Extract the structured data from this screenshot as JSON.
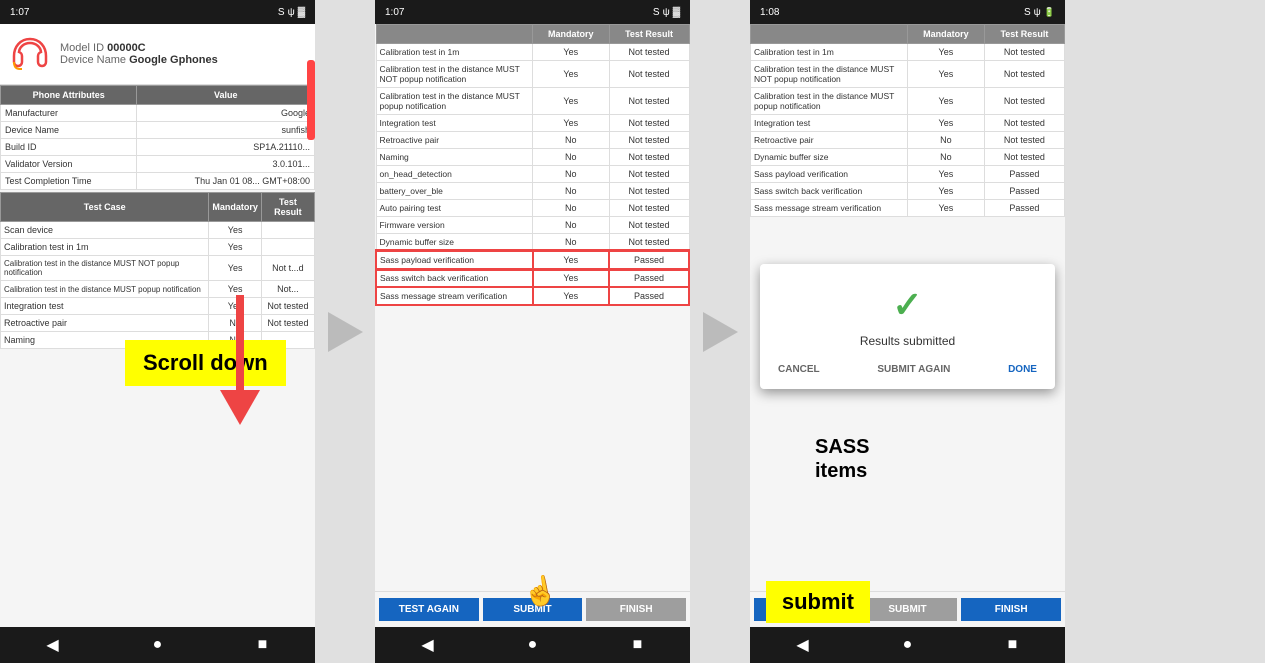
{
  "screen1": {
    "statusbar": {
      "time": "1:07",
      "icons": "S ψ ▲"
    },
    "device": {
      "model_label": "Model ID",
      "model_value": "00000C",
      "name_label": "Device Name",
      "name_value": "Google Gphones"
    },
    "attributes_header": [
      "Phone Attributes",
      "Value"
    ],
    "attributes": [
      {
        "name": "Manufacturer",
        "value": "Google"
      },
      {
        "name": "Device Name",
        "value": "sunfish"
      },
      {
        "name": "Build ID",
        "value": "SP1A.21110..."
      },
      {
        "name": "Validator Version",
        "value": "3.0.101..."
      },
      {
        "name": "Test Completion Time",
        "value": "Thu Jan 01 08... GMT+08:00"
      }
    ],
    "test_header": [
      "Test Case",
      "Mandatory",
      "Test Result"
    ],
    "tests": [
      {
        "name": "Scan device",
        "mandatory": "Yes",
        "result": ""
      },
      {
        "name": "Calibration test in 1m",
        "mandatory": "Yes",
        "result": ""
      },
      {
        "name": "Calibration test in the distance MUST NOT popup notification",
        "mandatory": "Yes",
        "result": "Not t...d"
      },
      {
        "name": "Calibration test in the distance MUST popup notification",
        "mandatory": "Yes",
        "result": "Not..."
      },
      {
        "name": "Integration test",
        "mandatory": "Yes",
        "result": "Not tested"
      },
      {
        "name": "Retroactive pair",
        "mandatory": "No",
        "result": "Not tested"
      },
      {
        "name": "Naming",
        "mandatory": "No",
        "result": ""
      }
    ],
    "scroll_annotation": "Scroll down",
    "navbar": [
      "◀",
      "●",
      "■"
    ]
  },
  "screen2": {
    "statusbar": {
      "time": "1:07",
      "icons": "S ψ ▲"
    },
    "test_header": [
      "",
      "Mandatory",
      "Test Result"
    ],
    "tests": [
      {
        "name": "Calibration test in 1m",
        "mandatory": "Yes",
        "result": "Not tested"
      },
      {
        "name": "Calibration test in the distance MUST NOT popup notification",
        "mandatory": "Yes",
        "result": "Not tested"
      },
      {
        "name": "Calibration test in the distance MUST popup notification",
        "mandatory": "Yes",
        "result": "Not tested"
      },
      {
        "name": "Integration test",
        "mandatory": "Yes",
        "result": "Not tested"
      },
      {
        "name": "Retroactive pair",
        "mandatory": "No",
        "result": "Not tested"
      },
      {
        "name": "Naming",
        "mandatory": "No",
        "result": "Not tested"
      },
      {
        "name": "on_head_detection",
        "mandatory": "No",
        "result": "Not tested"
      },
      {
        "name": "battery_over_ble",
        "mandatory": "No",
        "result": "Not tested"
      },
      {
        "name": "Auto pairing test",
        "mandatory": "No",
        "result": "Not tested"
      },
      {
        "name": "Firmware version",
        "mandatory": "No",
        "result": "Not tested"
      },
      {
        "name": "Dynamic buffer size",
        "mandatory": "No",
        "result": "Not tested"
      },
      {
        "name": "Sass payload verification",
        "mandatory": "Yes",
        "result": "Passed",
        "sass": true
      },
      {
        "name": "Sass switch back verification",
        "mandatory": "Yes",
        "result": "Passed",
        "sass": true
      },
      {
        "name": "Sass message stream verification",
        "mandatory": "Yes",
        "result": "Passed",
        "sass": true
      }
    ],
    "sass_label": "SASS\nitems",
    "buttons": {
      "test_again": "TEST AGAIN",
      "submit": "SUBMIT",
      "finish": "FINISH"
    },
    "navbar": [
      "◀",
      "●",
      "■"
    ]
  },
  "screen3": {
    "statusbar": {
      "time": "1:08",
      "icons": "S ψ ▲"
    },
    "test_header": [
      "",
      "Mandatory",
      "Test Result"
    ],
    "tests": [
      {
        "name": "Calibration test in 1m",
        "mandatory": "Yes",
        "result": "Not tested"
      },
      {
        "name": "Calibration test in the distance MUST NOT popup notification",
        "mandatory": "Yes",
        "result": "Not tested"
      },
      {
        "name": "Calibration test in the distance MUST popup notification",
        "mandatory": "Yes",
        "result": "Not tested"
      },
      {
        "name": "Integration test",
        "mandatory": "Yes",
        "result": "Not tested"
      },
      {
        "name": "Retroactive pair",
        "mandatory": "No",
        "result": "Not tested"
      },
      {
        "name": "Dynamic buffer size",
        "mandatory": "No",
        "result": "Not tested"
      },
      {
        "name": "Sass payload verification",
        "mandatory": "Yes",
        "result": "Passed"
      },
      {
        "name": "Sass switch back verification",
        "mandatory": "Yes",
        "result": "Passed"
      },
      {
        "name": "Sass message stream verification",
        "mandatory": "Yes",
        "result": "Passed"
      }
    ],
    "modal": {
      "check": "✓",
      "text": "Results submitted",
      "cancel": "CANCEL",
      "submit_again": "SUBMIT AGAIN",
      "done": "DONE"
    },
    "buttons": {
      "test_again": "TEST AGAIN",
      "submit": "SUBMIT",
      "finish": "FINISH"
    },
    "navbar": [
      "◀",
      "●",
      "■"
    ]
  },
  "annotations": {
    "scroll_down": "Scroll down",
    "sass_items": "SASS\nitems",
    "submit": "submit"
  },
  "colors": {
    "btn_blue": "#1565C0",
    "btn_grey": "#9e9e9e",
    "header_grey": "#666",
    "sass_red": "#e44",
    "green_check": "#4CAF50",
    "yellow": "#ffff00"
  }
}
